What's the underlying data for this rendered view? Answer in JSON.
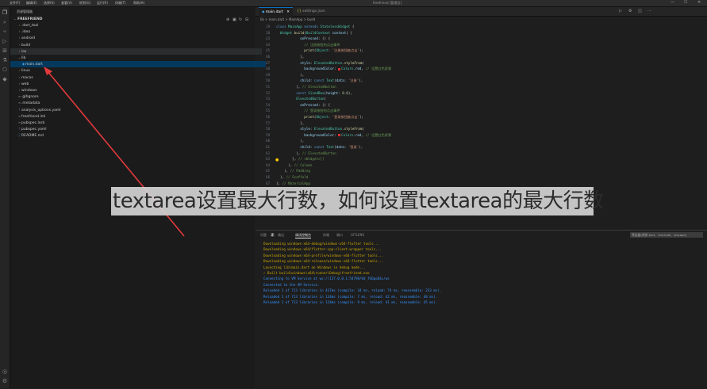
{
  "titlebar": {
    "menus": [
      "文件(F)",
      "编辑(E)",
      "选择(S)",
      "查看(V)",
      "转到(G)",
      "运行(R)",
      "终端(T)",
      "帮助(H)"
    ],
    "title": "freefriend [管理员]",
    "win_controls": [
      "—",
      "☐",
      "✕"
    ]
  },
  "activity_icons": [
    "files-icon",
    "search-icon",
    "source-control-icon",
    "run-debug-icon",
    "extensions-icon",
    "testing-icon",
    "remote-icon",
    "flutter-icon"
  ],
  "explorer": {
    "title": "资源管理器",
    "root": "FREEFRIEND",
    "items": [
      {
        "label": ".dart_tool",
        "type": "folder",
        "depth": 1
      },
      {
        "label": ".idea",
        "type": "folder",
        "depth": 1
      },
      {
        "label": "android",
        "type": "folder",
        "depth": 1
      },
      {
        "label": "build",
        "type": "folder",
        "depth": 1
      },
      {
        "label": "ios",
        "type": "folder",
        "depth": 1
      },
      {
        "label": "lib",
        "type": "folder-open",
        "depth": 1
      },
      {
        "label": "main.dart",
        "type": "dart",
        "depth": 2
      },
      {
        "label": "linux",
        "type": "folder",
        "depth": 1
      },
      {
        "label": "macos",
        "type": "folder",
        "depth": 1
      },
      {
        "label": "web",
        "type": "folder",
        "depth": 1
      },
      {
        "label": "windows",
        "type": "folder",
        "depth": 1
      },
      {
        "label": ".gitignore",
        "type": "file",
        "depth": 1
      },
      {
        "label": ".metadata",
        "type": "file",
        "depth": 1
      },
      {
        "label": "analysis_options.yaml",
        "type": "yaml",
        "depth": 1
      },
      {
        "label": "freefriend.iml",
        "type": "file",
        "depth": 1
      },
      {
        "label": "pubspec.lock",
        "type": "file",
        "depth": 1
      },
      {
        "label": "pubspec.yaml",
        "type": "yaml",
        "depth": 1
      },
      {
        "label": "README.md",
        "type": "md",
        "depth": 1
      }
    ]
  },
  "tabs": [
    {
      "label": "main.dart",
      "active": true
    },
    {
      "label": "settings.json",
      "active": false
    }
  ],
  "breadcrumb": "lib > main.dart > MainApp > build",
  "code": {
    "lines": [
      {
        "n": "19",
        "t": [
          [
            "kw",
            "class "
          ],
          [
            "cls",
            "MainApp "
          ],
          [
            "kw",
            "extends "
          ],
          [
            "cls",
            "StatelessWidget "
          ],
          [
            "pu",
            "{"
          ]
        ]
      },
      {
        "n": "20",
        "t": [
          [
            "pu",
            "  "
          ],
          [
            "cls",
            "Widget "
          ],
          [
            "fn",
            "build"
          ],
          [
            "pu",
            "("
          ],
          [
            "cls",
            "BuildContext "
          ],
          [
            "pr",
            "context"
          ],
          [
            "pu",
            ") {"
          ]
        ]
      },
      {
        "n": "43",
        "t": [
          [
            "pu",
            "            "
          ],
          [
            "pr",
            "onPressed"
          ],
          [
            "pu",
            ": () {"
          ]
        ]
      },
      {
        "n": "44",
        "t": [
          [
            "cm",
            "              // 注册按钮的点击事件"
          ]
        ]
      },
      {
        "n": "45",
        "t": [
          [
            "pu",
            "              "
          ],
          [
            "fn",
            "print"
          ],
          [
            "pu",
            "("
          ],
          [
            "cls",
            "Object"
          ],
          [
            "pu",
            ": "
          ],
          [
            "str",
            "'注册按钮被点击'"
          ],
          [
            "pu",
            ");"
          ]
        ]
      },
      {
        "n": "46",
        "t": [
          [
            "pu",
            "            },"
          ]
        ]
      },
      {
        "n": "47",
        "t": [
          [
            "pu",
            "            "
          ],
          [
            "pr",
            "style"
          ],
          [
            "pu",
            ": "
          ],
          [
            "cls",
            "ElevatedButton"
          ],
          [
            "pu",
            "."
          ],
          [
            "fn",
            "styleFrom"
          ],
          [
            "pu",
            "("
          ]
        ]
      },
      {
        "n": "48",
        "t": [
          [
            "pu",
            "              "
          ],
          [
            "pr",
            "backgroundColor"
          ],
          [
            "pu",
            ": "
          ],
          [
            "sw",
            ""
          ],
          [
            "cls",
            "Colors"
          ],
          [
            "pu",
            "."
          ],
          [
            "pr",
            "red"
          ],
          [
            "pu",
            ", "
          ],
          [
            "cm",
            "// 设置红色背景"
          ]
        ]
      },
      {
        "n": "49",
        "t": [
          [
            "pu",
            "            ),"
          ]
        ]
      },
      {
        "n": "50",
        "t": [
          [
            "pu",
            "            "
          ],
          [
            "pr",
            "child"
          ],
          [
            "pu",
            ": "
          ],
          [
            "kw",
            "const "
          ],
          [
            "cls",
            "Text"
          ],
          [
            "pu",
            "("
          ],
          [
            "pr",
            "data"
          ],
          [
            "pu",
            ": "
          ],
          [
            "str",
            "'注册'"
          ],
          [
            "pu",
            "),"
          ]
        ]
      },
      {
        "n": "51",
        "t": [
          [
            "pu",
            "          ), "
          ],
          [
            "cm",
            "// ElevatedButton"
          ]
        ]
      },
      {
        "n": "52",
        "t": [
          [
            "pu",
            "          "
          ],
          [
            "kw",
            "const "
          ],
          [
            "cls",
            "SizedBox"
          ],
          [
            "pu",
            "("
          ],
          [
            "pr",
            "height"
          ],
          [
            "pu",
            ": "
          ],
          [
            "num",
            "8.0"
          ],
          [
            "pu",
            "),"
          ]
        ]
      },
      {
        "n": "53",
        "t": [
          [
            "pu",
            "          "
          ],
          [
            "cls",
            "ElevatedButton"
          ],
          [
            "pu",
            "("
          ]
        ]
      },
      {
        "n": "54",
        "t": [
          [
            "pu",
            "            "
          ],
          [
            "pr",
            "onPressed"
          ],
          [
            "pu",
            ": () {"
          ]
        ]
      },
      {
        "n": "55",
        "t": [
          [
            "cm",
            "              // 登录按钮的点击事件"
          ]
        ]
      },
      {
        "n": "56",
        "t": [
          [
            "pu",
            "              "
          ],
          [
            "fn",
            "print"
          ],
          [
            "pu",
            "("
          ],
          [
            "cls",
            "Object"
          ],
          [
            "pu",
            ": "
          ],
          [
            "str",
            "'登录按钮被点击'"
          ],
          [
            "pu",
            ");"
          ]
        ]
      },
      {
        "n": "57",
        "t": [
          [
            "pu",
            "            },"
          ]
        ]
      },
      {
        "n": "58",
        "t": [
          [
            "pu",
            "            "
          ],
          [
            "pr",
            "style"
          ],
          [
            "pu",
            ": "
          ],
          [
            "cls",
            "ElevatedButton"
          ],
          [
            "pu",
            "."
          ],
          [
            "fn",
            "styleFrom"
          ],
          [
            "pu",
            "("
          ]
        ]
      },
      {
        "n": "59",
        "t": [
          [
            "pu",
            "              "
          ],
          [
            "pr",
            "backgroundColor"
          ],
          [
            "pu",
            ": "
          ],
          [
            "sw",
            ""
          ],
          [
            "cls",
            "Colors"
          ],
          [
            "pu",
            "."
          ],
          [
            "pr",
            "red"
          ],
          [
            "pu",
            ", "
          ],
          [
            "cm",
            "// 设置红色背景"
          ]
        ]
      },
      {
        "n": "60",
        "t": [
          [
            "pu",
            "            ),"
          ]
        ]
      },
      {
        "n": "61",
        "t": [
          [
            "pu",
            "            "
          ],
          [
            "pr",
            "child"
          ],
          [
            "pu",
            ": "
          ],
          [
            "kw",
            "const "
          ],
          [
            "cls",
            "Text"
          ],
          [
            "pu",
            "("
          ],
          [
            "pr",
            "data"
          ],
          [
            "pu",
            ": "
          ],
          [
            "str",
            "'登录'"
          ],
          [
            "pu",
            "),"
          ]
        ]
      },
      {
        "n": "62",
        "t": [
          [
            "pu",
            "          ), "
          ],
          [
            "cm",
            "// ElevatedButton"
          ]
        ]
      },
      {
        "n": "63",
        "t": [
          [
            "pu",
            "        ], "
          ],
          [
            "cm",
            "// <Widget>[]"
          ]
        ]
      },
      {
        "n": "64",
        "t": [
          [
            "pu",
            "      ), "
          ],
          [
            "cm",
            "// Column"
          ]
        ]
      },
      {
        "n": "65",
        "t": [
          [
            "pu",
            "    ), "
          ],
          [
            "cm",
            "// Padding"
          ]
        ]
      },
      {
        "n": "66",
        "t": [
          [
            "pu",
            "  ), "
          ],
          [
            "cm",
            "// Scaffold"
          ]
        ]
      },
      {
        "n": "67",
        "t": [
          [
            "pu",
            "); "
          ],
          [
            "cm",
            "// MaterialApp"
          ]
        ]
      }
    ]
  },
  "panel": {
    "tabs": [
      "问题",
      "输出",
      "调试控制台",
      "终端",
      "端口",
      "GITLENS"
    ],
    "problem_count": "2",
    "active_tab": "调试控制台",
    "filter_placeholder": "筛选器(例如 text、!exclude、\\escape)",
    "output": [
      {
        "c": "y",
        "t": "Downloading windows-x64-debug/windows-x64-flutter tools..."
      },
      {
        "c": "y",
        "t": "Downloading windows-x64/flutter-cpp-client-wrapper tools..."
      },
      {
        "c": "y",
        "t": "Downloading windows-x64-profile/windows-x64-flutter tools..."
      },
      {
        "c": "y",
        "t": "Downloading windows-x64-release/windows-x64-flutter tools..."
      },
      {
        "c": "y",
        "t": "Launching lib\\main.dart on Windows in debug mode..."
      },
      {
        "c": "y",
        "t": "✓ Built build\\windows\\x64\\runner\\Debug\\freefriend.exe"
      },
      {
        "c": "b",
        "t": "Connecting to VM Service at ws://127.0.0.1:54798/Ud_fXQpo04=/ws"
      },
      {
        "c": "b",
        "t": "Connected to the VM Service."
      },
      {
        "c": "b",
        "t": "Reloaded 1 of 713 libraries in 437ms (compile: 34 ms, reload: 74 ms, reassemble: 233 ms)."
      },
      {
        "c": "b",
        "t": "Reloaded 1 of 713 libraries in 134ms (compile: 7 ms, reload: 42 ms, reassemble: 48 ms)."
      },
      {
        "c": "b",
        "t": "Reloaded 1 of 713 libraries in 124ms (compile: 9 ms, reload: 41 ms, reassemble: 45 ms)."
      }
    ]
  },
  "banner": "textarea设置最大行数，如何设置textarea的最大行数",
  "colors": {
    "arrow": "#e23a3a",
    "accent": "#0e70c0"
  }
}
